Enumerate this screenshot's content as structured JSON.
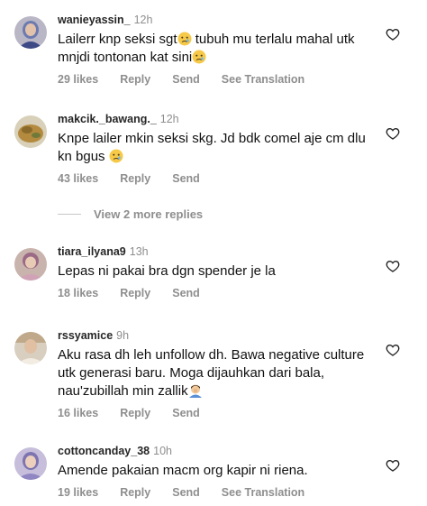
{
  "comments": [
    {
      "username": "wanieyassin_",
      "time": "12h",
      "text_parts": [
        "Lailerr knp seksi sgt",
        " tubuh mu terlalu mahal utk mnjdi tontonan kat sini"
      ],
      "likes": "29 likes",
      "reply": "Reply",
      "send": "Send",
      "translate": "See Translation",
      "emoji": "crying-face"
    },
    {
      "username": "makcik._bawang._",
      "time": "12h",
      "text_parts": [
        "Knpe lailer mkin seksi skg. Jd bdk comel aje cm dlu kn bgus "
      ],
      "likes": "43 likes",
      "reply": "Reply",
      "send": "Send",
      "emoji": "crying-face"
    },
    {
      "username": "tiara_ilyana9",
      "time": "13h",
      "text_parts": [
        "Lepas ni pakai bra dgn spender je la"
      ],
      "likes": "18 likes",
      "reply": "Reply",
      "send": "Send"
    },
    {
      "username": "rssyamice",
      "time": "9h",
      "text_parts": [
        "Aku rasa dh leh unfollow dh. Bawa negative culture utk generasi baru. Moga dijauhkan dari bala, nau'zubillah min zallik"
      ],
      "likes": "16 likes",
      "reply": "Reply",
      "send": "Send",
      "emoji": "man-facepalming"
    },
    {
      "username": "cottoncanday_38",
      "time": "10h",
      "text_parts": [
        "Amende pakaian macm org kapir ni riena."
      ],
      "likes": "19 likes",
      "reply": "Reply",
      "send": "Send",
      "translate": "See Translation"
    }
  ],
  "view_replies": "View 2 more replies",
  "icons": {
    "like": "heart-outline-icon"
  },
  "colors": {
    "muted": "#8e8e8e",
    "text": "#111111"
  }
}
